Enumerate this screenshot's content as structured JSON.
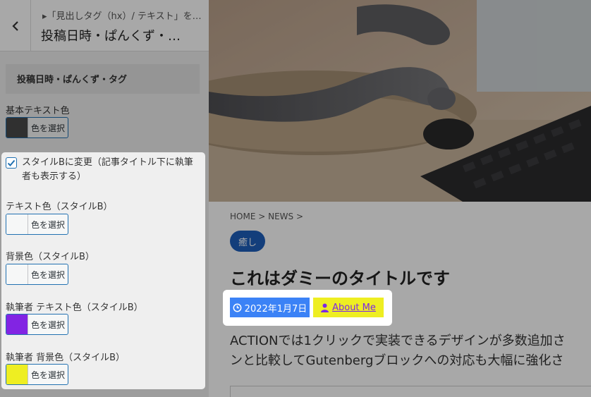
{
  "sidebar": {
    "breadcrumb": "▸「見出しタグ（hx）/ テキスト」を…",
    "title": "投稿日時・ぱんくず・…",
    "section_heading": "投稿日時・ぱんくず・タグ",
    "base_text_color": {
      "label": "基本テキスト色",
      "button": "色を選択",
      "swatch": "#4a4a4a"
    },
    "style_b_checkbox": {
      "label": "スタイルBに変更（記事タイトル下に執筆者も表示する）",
      "checked": true
    },
    "text_color_b": {
      "label": "テキスト色（スタイルB）",
      "button": "色を選択",
      "swatch": "#f6f7f7"
    },
    "bg_color_b": {
      "label": "背景色（スタイルB）",
      "button": "色を選択",
      "swatch": "#f6f7f7"
    },
    "author_text_color_b": {
      "label": "執筆者 テキスト色（スタイルB）",
      "button": "色を選択",
      "swatch": "#8224e3"
    },
    "author_bg_color_b": {
      "label": "執筆者 背景色（スタイルB）",
      "button": "色を選択",
      "swatch": "#eeee22"
    }
  },
  "preview": {
    "breadcrumb": "HOME >  NEWS >",
    "tag": "癒し",
    "title": "これはダミーのタイトルです",
    "date": "2022年1月7日",
    "author": "About Me",
    "body_line1": "ACTIONでは1クリックで実装できるデザインが多数追加さ",
    "body_line2": "ンと比較してGutenbergブロックへの対応も大幅に強化さ",
    "colors": {
      "date_bg": "#3b82f6",
      "author_bg": "#eeee22",
      "author_text": "#7c27e6",
      "tag_bg": "#1e5fbb"
    }
  }
}
